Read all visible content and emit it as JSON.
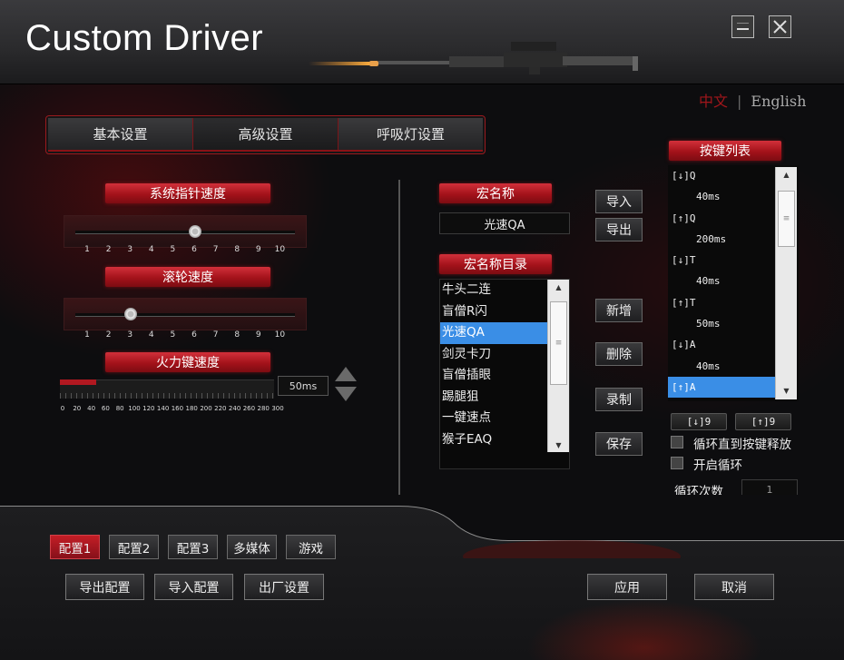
{
  "window": {
    "title": "Custom Driver",
    "minimize_label": "—",
    "close_label": "✕"
  },
  "language": {
    "zh": "中文",
    "separator": "|",
    "en": "English"
  },
  "tabs": [
    {
      "label": "基本设置",
      "active": false
    },
    {
      "label": "高级设置",
      "active": true
    },
    {
      "label": "呼吸灯设置",
      "active": false
    }
  ],
  "pointer_speed": {
    "label": "系统指针速度",
    "ticks": [
      "1",
      "2",
      "3",
      "4",
      "5",
      "6",
      "7",
      "8",
      "9",
      "10"
    ],
    "value": 6
  },
  "scroll_speed": {
    "label": "滚轮速度",
    "ticks": [
      "1",
      "2",
      "3",
      "4",
      "5",
      "6",
      "7",
      "8",
      "9",
      "10"
    ],
    "value": 3
  },
  "fire_speed": {
    "label": "火力键速度",
    "value": "50ms",
    "ticks": [
      "0",
      "20",
      "40",
      "60",
      "80",
      "100",
      "120",
      "140",
      "160",
      "180",
      "200",
      "220",
      "240",
      "260",
      "280",
      "300"
    ]
  },
  "macro": {
    "name_label": "宏名称",
    "name_value": "光速QA",
    "import_label": "导入",
    "export_label": "导出",
    "dir_label": "宏名称目录",
    "items": [
      "牛头二连",
      "盲僧R闪",
      "光速QA",
      "剑灵卡刀",
      "盲僧插眼",
      "踢腿狙",
      "一键速点",
      "猴子EAQ"
    ],
    "selected_index": 2,
    "new_label": "新增",
    "delete_label": "删除",
    "record_label": "录制",
    "save_label": "保存"
  },
  "key_list": {
    "label": "按键列表",
    "rows": [
      {
        "text": "[↓]Q",
        "kind": "key"
      },
      {
        "text": "40ms",
        "kind": "delay"
      },
      {
        "text": "[↑]Q",
        "kind": "key"
      },
      {
        "text": "200ms",
        "kind": "delay"
      },
      {
        "text": "[↓]T",
        "kind": "key"
      },
      {
        "text": "40ms",
        "kind": "delay"
      },
      {
        "text": "[↑]T",
        "kind": "key"
      },
      {
        "text": "50ms",
        "kind": "delay"
      },
      {
        "text": "[↓]A",
        "kind": "key"
      },
      {
        "text": "40ms",
        "kind": "delay"
      },
      {
        "text": "[↑]A",
        "kind": "key",
        "selected": true
      }
    ],
    "key_down_btn": "[↓]9",
    "key_up_btn": "[↑]9",
    "loop_until_release": "循环直到按键释放",
    "enable_loop": "开启循环",
    "loop_count_label": "循环次数",
    "loop_count_value": "1"
  },
  "profiles": [
    {
      "label": "配置1",
      "active": true
    },
    {
      "label": "配置2",
      "active": false
    },
    {
      "label": "配置3",
      "active": false
    },
    {
      "label": "多媒体",
      "active": false
    },
    {
      "label": "游戏",
      "active": false
    }
  ],
  "actions": {
    "export_config": "导出配置",
    "import_config": "导入配置",
    "factory_reset": "出厂设置",
    "apply": "应用",
    "cancel": "取消"
  },
  "colors": {
    "accent_red": "#b0151c",
    "selection_blue": "#3a8ee6"
  }
}
